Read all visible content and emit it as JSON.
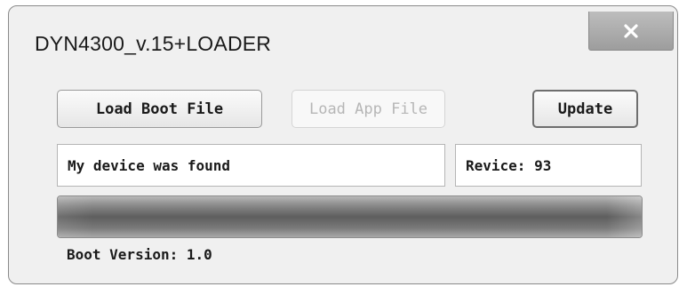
{
  "window": {
    "title": "DYN4300_v.15+LOADER",
    "close_icon": "close-x-icon"
  },
  "buttons": {
    "load_boot": "Load Boot File",
    "load_app": "Load App File",
    "load_app_enabled": false,
    "update": "Update"
  },
  "status": {
    "message": "My device was found",
    "revice": "Revice: 93"
  },
  "progress": {
    "fraction": 1.0
  },
  "footer": {
    "boot_version": "Boot Version: 1.0"
  },
  "colors": {
    "window_bg": "#f0f0f0",
    "disabled_text": "#b6b6b6",
    "progress_fill": "#5e5e5e"
  }
}
